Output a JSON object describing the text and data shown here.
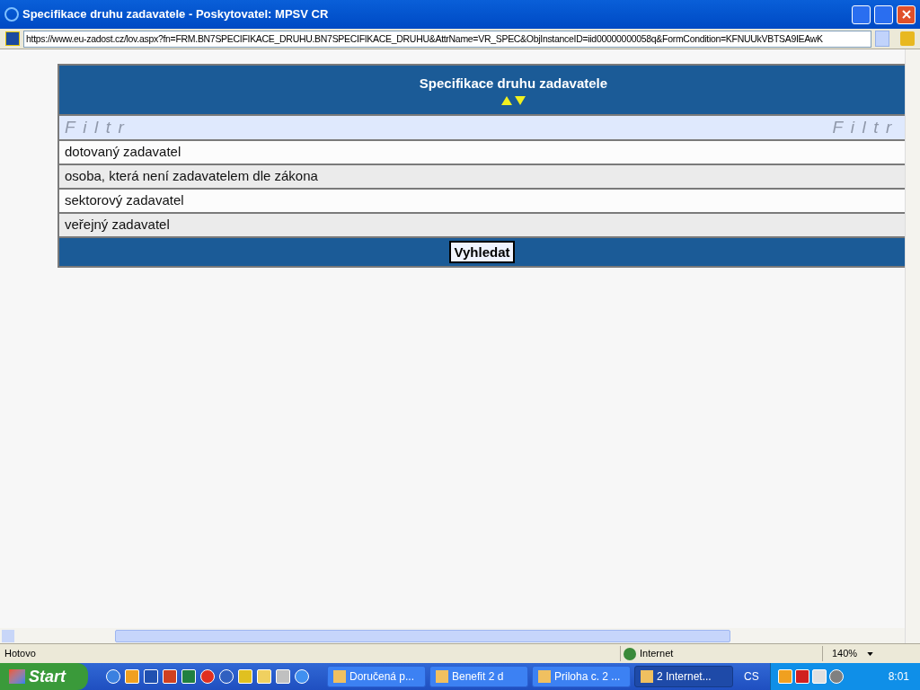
{
  "window": {
    "title": "Specifikace druhu zadavatele - Poskytovatel: MPSV CR"
  },
  "address": "https://www.eu-zadost.cz/lov.aspx?fn=FRM.BN7SPECIFIKACE_DRUHU.BN7SPECIFIKACE_DRUHU&AttrName=VR_SPEC&ObjInstanceID=iid00000000058q&FormCondition=KFNUUkVBTSA9IEAwK",
  "table": {
    "title": "Specifikace druhu zadavatele",
    "filter_left": "Filtr",
    "filter_right": "Filtr",
    "rows": [
      "dotovaný zadavatel",
      "osoba, která není zadavatelem dle zákona",
      "sektorový zadavatel",
      "veřejný zadavatel"
    ],
    "button": "Vyhledat"
  },
  "status_bar": {
    "text": "Hotovo",
    "zone": "Internet",
    "zoom": "140%"
  },
  "taskbar": {
    "start": "Start",
    "tasks": [
      {
        "label": "Doručená p...",
        "selected": false
      },
      {
        "label": "Benefit 2 d",
        "selected": false
      },
      {
        "label": "Priloha c. 2 ...",
        "selected": false
      },
      {
        "label": "2 Internet...",
        "selected": true
      }
    ],
    "language": "CS",
    "time": "8:01"
  }
}
